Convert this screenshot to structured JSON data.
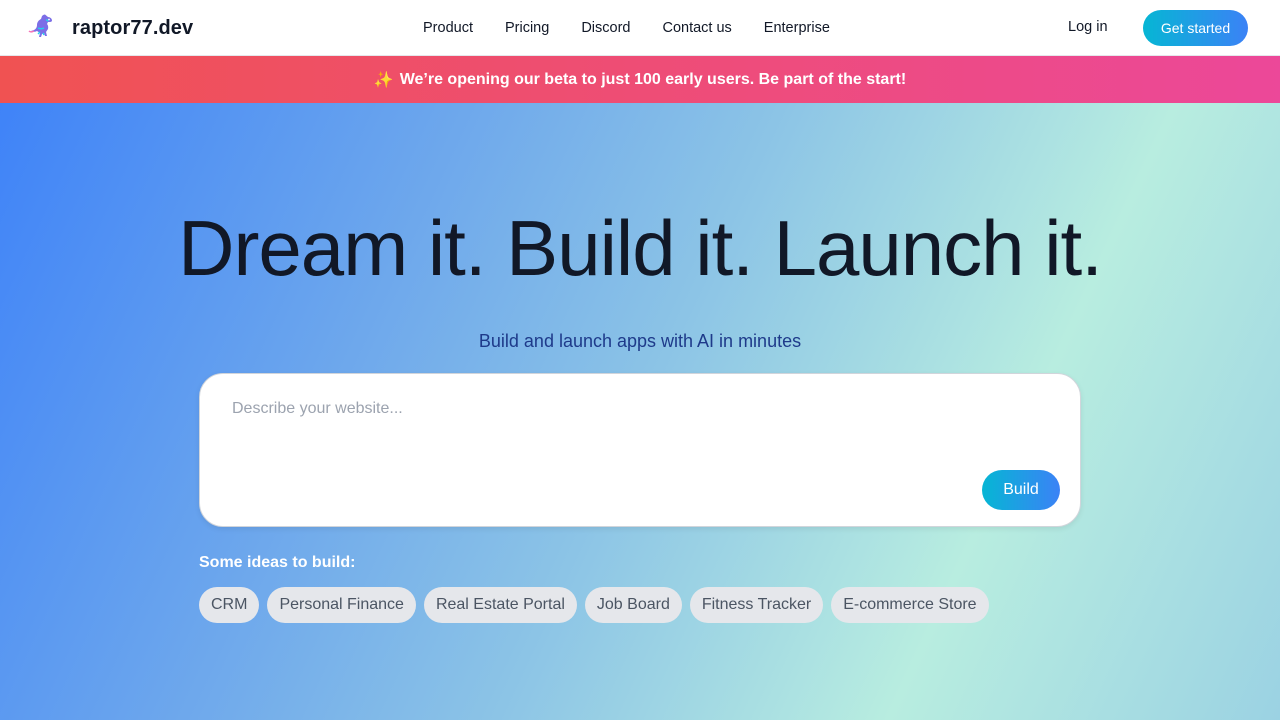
{
  "brand": {
    "name": "raptor77.dev",
    "logo_icon": "raptor-logo-icon"
  },
  "nav": {
    "links": [
      "Product",
      "Pricing",
      "Discord",
      "Contact us",
      "Enterprise"
    ],
    "login": "Log in",
    "get_started": "Get started"
  },
  "banner": {
    "icon": "✨",
    "text": "We’re opening our beta to just 100 early users. Be part of the start!"
  },
  "hero": {
    "headline": "Dream it. Build it. Launch it.",
    "subhead": "Build and launch apps with AI in minutes",
    "prompt_placeholder": "Describe your website...",
    "prompt_value": "",
    "build_label": "Build",
    "ideas_label": "Some ideas to build:",
    "ideas": [
      "CRM",
      "Personal Finance",
      "Real Estate Portal",
      "Job Board",
      "Fitness Tracker",
      "E-commerce Store"
    ]
  },
  "colors": {
    "accent_gradient_start": "#06b6d4",
    "accent_gradient_end": "#3b82f6",
    "banner_start": "#f05252",
    "banner_end": "#ec4899"
  }
}
